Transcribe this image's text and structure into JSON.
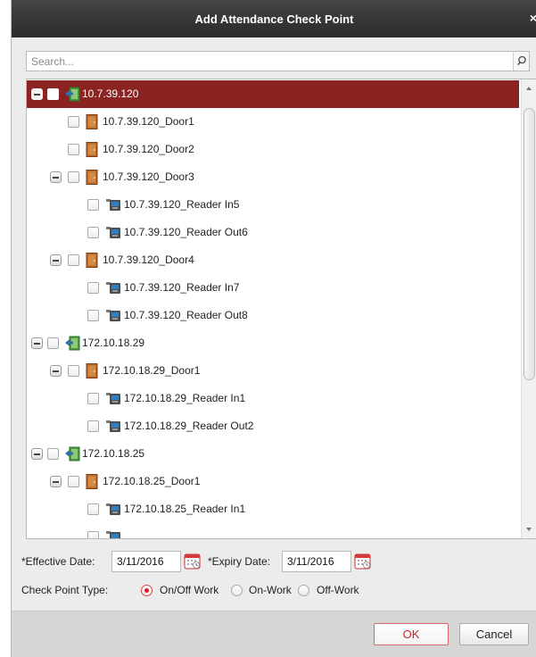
{
  "dialog": {
    "title": "Add Attendance Check Point",
    "close_glyph": "×"
  },
  "search": {
    "placeholder": "Search...",
    "icon": "search-icon"
  },
  "tree": {
    "selected_color": "#8c2323",
    "nodes": [
      {
        "label": "10.7.39.120",
        "type": "device",
        "level": 0,
        "expanded": true,
        "selected": true
      },
      {
        "label": "10.7.39.120_Door1",
        "type": "door",
        "level": 1
      },
      {
        "label": "10.7.39.120_Door2",
        "type": "door",
        "level": 1
      },
      {
        "label": "10.7.39.120_Door3",
        "type": "door",
        "level": 1,
        "expanded": true
      },
      {
        "label": "10.7.39.120_Reader In5",
        "type": "reader",
        "level": 2
      },
      {
        "label": "10.7.39.120_Reader Out6",
        "type": "reader",
        "level": 2
      },
      {
        "label": "10.7.39.120_Door4",
        "type": "door",
        "level": 1,
        "expanded": true
      },
      {
        "label": "10.7.39.120_Reader In7",
        "type": "reader",
        "level": 2
      },
      {
        "label": "10.7.39.120_Reader Out8",
        "type": "reader",
        "level": 2
      },
      {
        "label": "172.10.18.29",
        "type": "device",
        "level": 0,
        "expanded": true
      },
      {
        "label": "172.10.18.29_Door1",
        "type": "door",
        "level": 1,
        "expanded": true
      },
      {
        "label": "172.10.18.29_Reader In1",
        "type": "reader",
        "level": 2
      },
      {
        "label": "172.10.18.29_Reader Out2",
        "type": "reader",
        "level": 2
      },
      {
        "label": "172.10.18.25",
        "type": "device",
        "level": 0,
        "expanded": true
      },
      {
        "label": "172.10.18.25_Door1",
        "type": "door",
        "level": 1,
        "expanded": true
      },
      {
        "label": "172.10.18.25_Reader In1",
        "type": "reader",
        "level": 2
      },
      {
        "label": "",
        "type": "reader",
        "level": 2
      }
    ]
  },
  "form": {
    "effective_label": "*Effective Date:",
    "effective_value": "3/11/2016",
    "expiry_label": "*Expiry Date:",
    "expiry_value": "3/11/2016",
    "type_label": "Check Point Type:",
    "options": [
      {
        "label": "On/Off Work",
        "checked": true
      },
      {
        "label": "On-Work",
        "checked": false
      },
      {
        "label": "Off-Work",
        "checked": false
      }
    ]
  },
  "buttons": {
    "ok": "OK",
    "cancel": "Cancel"
  }
}
